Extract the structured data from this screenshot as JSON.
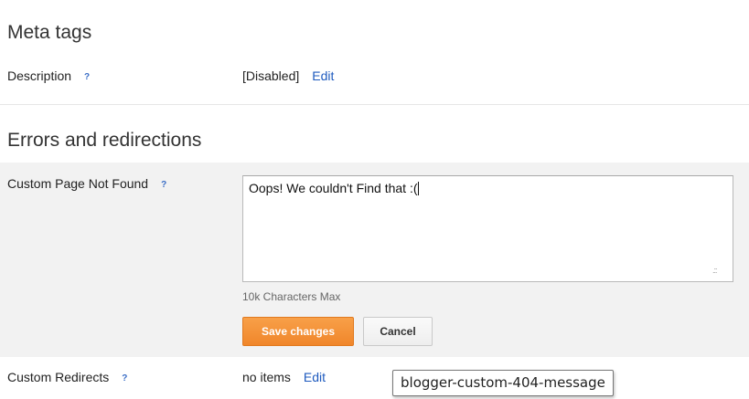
{
  "meta_tags": {
    "title": "Meta tags",
    "description": {
      "label": "Description",
      "help": "?",
      "value": "[Disabled]",
      "edit": "Edit"
    }
  },
  "errors": {
    "title": "Errors and redirections",
    "not_found": {
      "label": "Custom Page Not Found",
      "help": "?",
      "text": "Oops! We couldn't Find that :(",
      "hint": "10k Characters Max",
      "save": "Save changes",
      "cancel": "Cancel"
    },
    "redirects": {
      "label": "Custom Redirects",
      "help": "?",
      "value": "no items",
      "edit": "Edit"
    }
  },
  "tooltip": "blogger-custom-404-message",
  "colors": {
    "accent": "#f0862a",
    "link": "#1f5bbf",
    "panel": "#f2f2f2"
  }
}
